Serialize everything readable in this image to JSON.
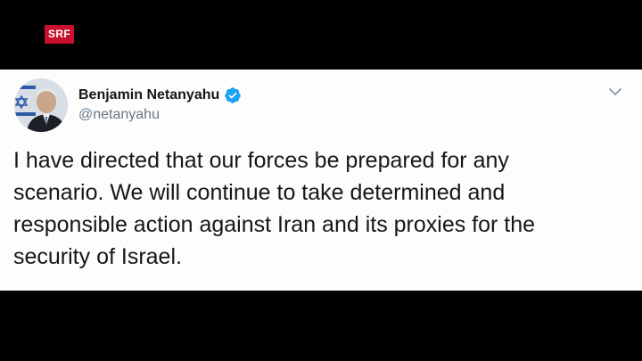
{
  "broadcaster": {
    "logo_text": "SRF",
    "logo_color": "#c8102e"
  },
  "tweet": {
    "author": {
      "display_name": "Benjamin Netanyahu",
      "handle": "@netanyahu",
      "verified": true,
      "avatar_icon": "profile-photo-avatar"
    },
    "menu_icon": "chevron-down-icon",
    "text_lines": [
      "I have directed that our forces be prepared for any",
      "scenario. We will continue to take determined and",
      "responsible action against Iran and its proxies for the",
      "security of Israel."
    ]
  },
  "colors": {
    "background": "#000000",
    "card": "#fdfdfd",
    "text": "#14171a",
    "secondary_text": "#657786",
    "verified_blue": "#1da1f2"
  }
}
